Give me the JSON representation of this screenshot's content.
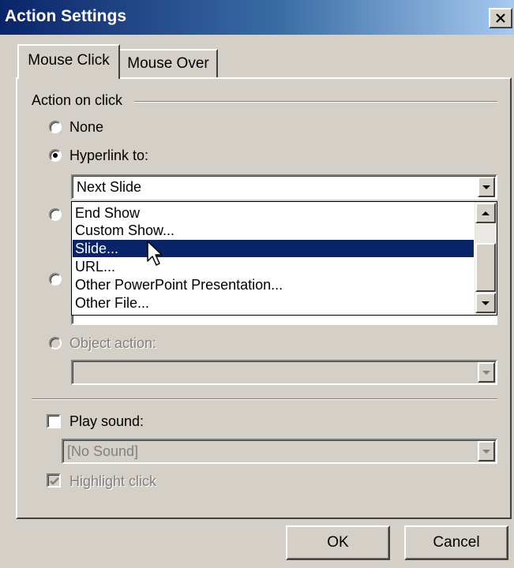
{
  "window": {
    "title": "Action Settings",
    "close_icon": "close-icon"
  },
  "tabs": [
    {
      "label": "Mouse Click",
      "active": true
    },
    {
      "label": "Mouse Over",
      "active": false
    }
  ],
  "action_group": {
    "label": "Action on click",
    "options": {
      "none": {
        "label": "None",
        "selected": false
      },
      "hyperlink": {
        "label": "Hyperlink to:",
        "selected": true,
        "value": "Next Slide"
      },
      "object_action": {
        "label": "Object action:",
        "selected": false,
        "enabled": false,
        "value": ""
      }
    },
    "dropdown_items": [
      "End Show",
      "Custom Show...",
      "Slide...",
      "URL...",
      "Other PowerPoint Presentation...",
      "Other File..."
    ],
    "dropdown_selected": "Slide..."
  },
  "sound": {
    "play_sound_label": "Play sound:",
    "play_sound_checked": false,
    "sound_value": "[No Sound]",
    "sound_enabled": false
  },
  "highlight": {
    "label": "Highlight click",
    "checked": true,
    "enabled": false
  },
  "buttons": {
    "ok": "OK",
    "cancel": "Cancel"
  },
  "colors": {
    "title_bar": "#0a246a",
    "face": "#d4d0c8",
    "selection": "#0a246a"
  }
}
